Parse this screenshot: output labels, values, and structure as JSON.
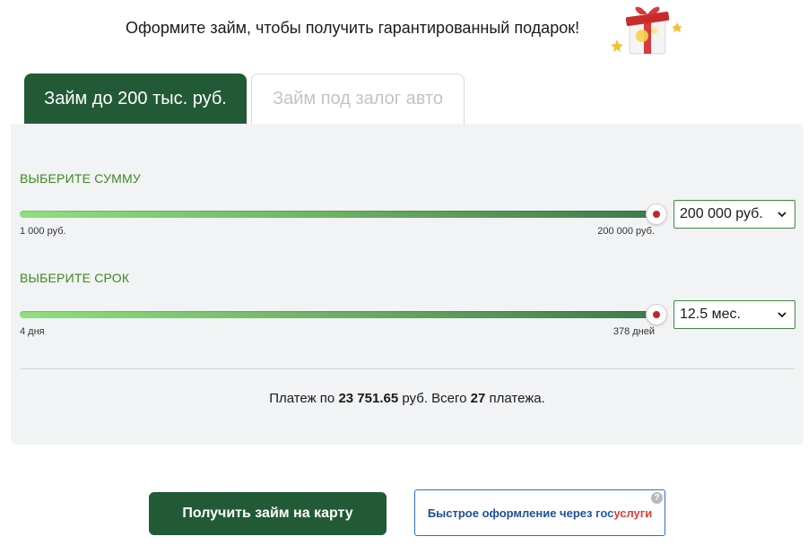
{
  "promo": {
    "text": "Оформите займ, чтобы получить гарантированный подарок!",
    "gift_icon": "gift-box-icon"
  },
  "tabs": [
    {
      "label": "Займ до 200 тыс. руб.",
      "active": true
    },
    {
      "label": "Займ под залог авто",
      "active": false
    }
  ],
  "amount": {
    "label": "ВЫБЕРИТЕ СУММУ",
    "min_label": "1 000 руб.",
    "max_label": "200 000 руб.",
    "value_fraction": 1.0,
    "selected": "200 000 руб."
  },
  "term": {
    "label": "ВЫБЕРИТЕ СРОК",
    "min_label": "4 дня",
    "max_label": "378 дней",
    "value_fraction": 1.0,
    "selected": "12.5 мес."
  },
  "summary": {
    "prefix": "Платеж по ",
    "payment": "23 751.65",
    "middle": " руб. Всего ",
    "count": "27",
    "suffix": " платежа."
  },
  "buttons": {
    "get_loan": "Получить займ на карту",
    "gosuslugi_prefix": "Быстрое оформление через ",
    "gosuslugi_part1": "гос",
    "gosuslugi_part2": "услуги",
    "help": "?"
  },
  "colors": {
    "primary_green": "#235a36",
    "label_green": "#3b8a1d",
    "handle_dot": "#c0262d",
    "gosuslugi_blue": "#1d5bb8",
    "gosuslugi_red": "#e23a3a"
  }
}
